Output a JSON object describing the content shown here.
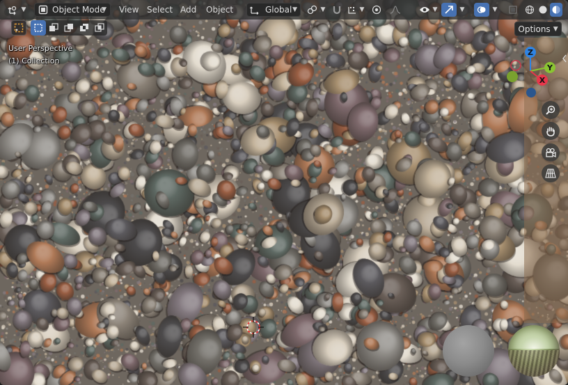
{
  "header": {
    "editor_type_icon": "transform-orientation-icon",
    "mode_label": "Object Mode",
    "menus": [
      "View",
      "Select",
      "Add",
      "Object"
    ],
    "orientation_label": "Global",
    "options_label": "Options"
  },
  "overlay": {
    "perspective_label": "User Perspective",
    "collection_label": "(1) Collection"
  },
  "gizmo": {
    "x_label": "X",
    "y_label": "Y",
    "z_label": "Z",
    "x_color": "#e8364b",
    "y_color": "#8ac532",
    "z_color": "#2f84e3"
  },
  "colors": {
    "header_bg": "#303030",
    "accent": "#4772b3",
    "sidepanel": "#8c6e50"
  }
}
